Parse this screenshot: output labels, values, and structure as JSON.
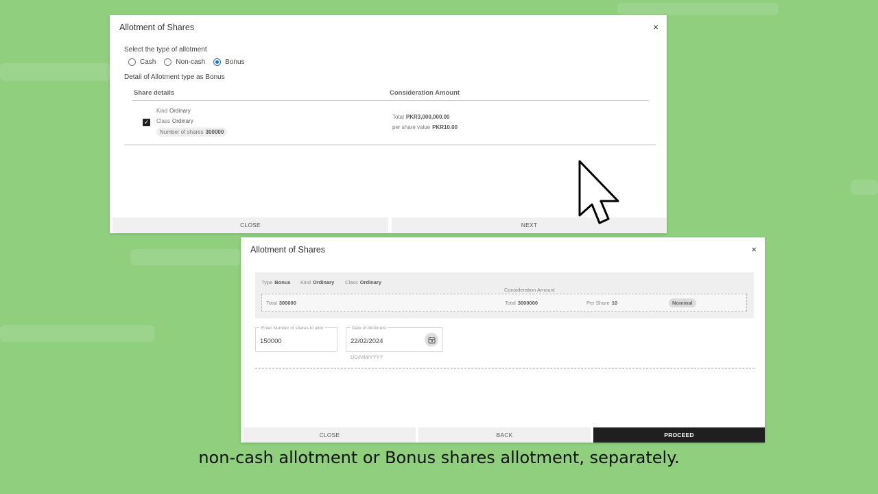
{
  "dialog1": {
    "title": "Allotment of Shares",
    "close_icon": "×",
    "select_label": "Select the type of allotment",
    "options": [
      {
        "label": "Cash",
        "selected": false
      },
      {
        "label": "Non-cash",
        "selected": false
      },
      {
        "label": "Bonus",
        "selected": true
      }
    ],
    "detail_label": "Detail of Allotment type as Bonus",
    "columns": [
      "Share details",
      "Consideration Amount"
    ],
    "row": {
      "checked": true,
      "kind_label": "Kind",
      "kind_value": "Ordinary",
      "class_label": "Class",
      "class_value": "Ordinary",
      "shares_label": "Number of shares",
      "shares_value": "300000",
      "total_label": "Total",
      "total_value": "PKR3,000,000.00",
      "per_share_label": "per share value",
      "per_share_value": "PKR10.00"
    },
    "close_btn": "CLOSE",
    "next_btn": "NEXT"
  },
  "dialog2": {
    "title": "Allotment of Shares",
    "close_icon": "×",
    "summary": {
      "type_label": "Type",
      "type_value": "Bonus",
      "kind_label": "Kind",
      "kind_value": "Ordinary",
      "class_label": "Class",
      "class_value": "Ordinary",
      "consideration_label": "Consideration Amount",
      "total_label": "Total",
      "total_value": "300000",
      "ctotal_label": "Total",
      "ctotal_value": "3000000",
      "per_share_label": "Per Share",
      "per_share_value": "10",
      "nominal": "Nominal"
    },
    "shares_field": {
      "label": "Enter Number of shares to allot",
      "value": "150000"
    },
    "date_field": {
      "label": "Date of Allotment",
      "value": "22/02/2024",
      "hint": "DD/MM/YYYY"
    },
    "close_btn": "CLOSE",
    "back_btn": "BACK",
    "proceed_btn": "PROCEED"
  },
  "caption": "non-cash allotment or Bonus shares allotment, separately.",
  "colors": {
    "background": "#8fcf7e",
    "accent": "#1a73c9",
    "proceed": "#1f1f1f"
  }
}
